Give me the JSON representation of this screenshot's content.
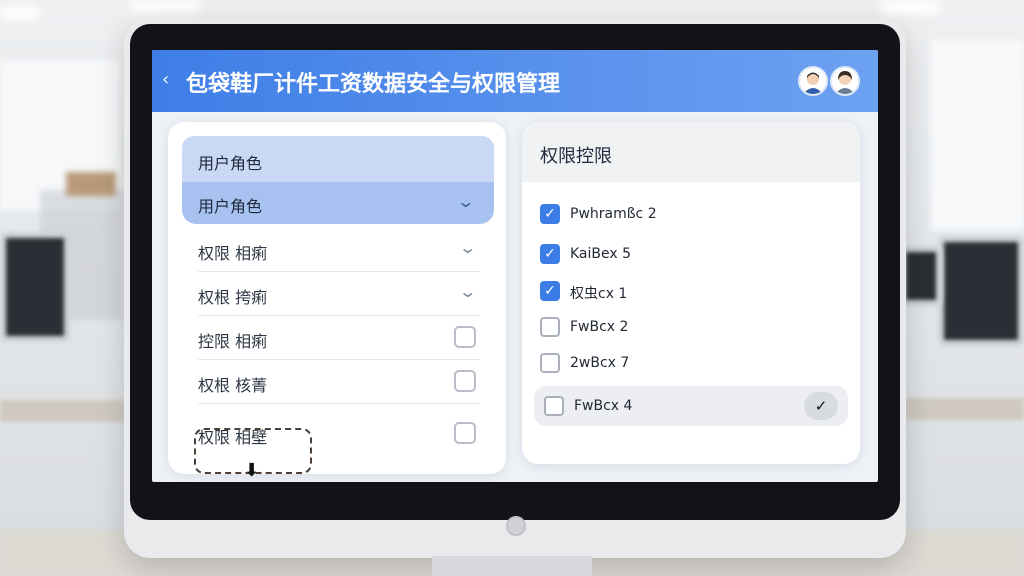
{
  "app": {
    "title": "包袋鞋厂计件工资数据安全与权限管理",
    "back_symbol": "‹"
  },
  "roles_panel": {
    "header": "用户角色",
    "selected": "用户角色",
    "items": [
      {
        "label": "权限 相痢",
        "control": "chevron"
      },
      {
        "label": "权根 挎痢",
        "control": "chevron"
      },
      {
        "label": "控限 相痢",
        "control": "checkbox"
      },
      {
        "label": "权根 核菁",
        "control": "checkbox"
      },
      {
        "label": "权限 相壁",
        "control": "checkbox"
      }
    ]
  },
  "permissions_panel": {
    "header": "权限控限",
    "items": [
      {
        "label": "Pwhramßc 2",
        "checked": true
      },
      {
        "label": "KaiBex 5",
        "checked": true
      },
      {
        "label": "权虫cx 1",
        "checked": true
      },
      {
        "label": "FwBcx 2",
        "checked": false
      },
      {
        "label": "2wBcx 7",
        "checked": false
      },
      {
        "label": "FwBcx 4",
        "checked": false
      }
    ]
  },
  "icons": {
    "chevron": "⌄",
    "check": "✓",
    "drag_arrow": "⬇"
  },
  "colors": {
    "header_blue": "#3e7ee6",
    "accent": "#3b7de4",
    "selected_role": "#a7c2f0"
  }
}
